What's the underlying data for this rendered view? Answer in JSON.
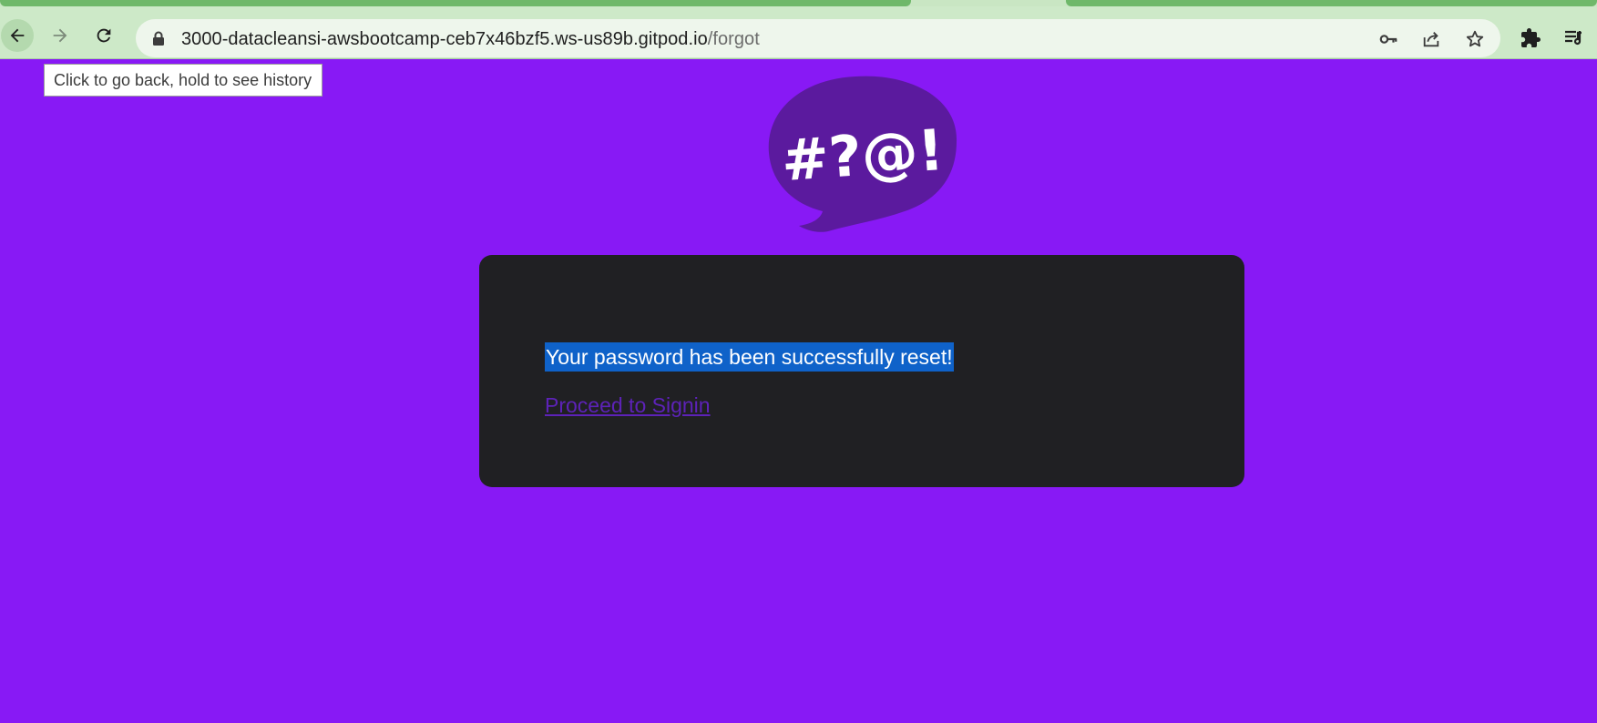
{
  "browser": {
    "url_host": "3000-datacleansi-awsbootcamp-ceb7x46bzf5.ws-us89b.gitpod.io",
    "url_path": "/forgot",
    "back_tooltip": "Click to go back, hold to see history",
    "icons": [
      "back-arrow-icon",
      "forward-arrow-icon",
      "reload-icon",
      "lock-icon",
      "key-icon",
      "share-icon",
      "star-icon",
      "extensions-puzzle-icon",
      "reading-list-icon"
    ]
  },
  "page": {
    "background_color": "#8819f5",
    "logo": {
      "text": "#?@!",
      "bubble_color": "#5b1a9e"
    },
    "card": {
      "background_color": "#202023",
      "message": "Your password has been successfully reset!",
      "link": "Proceed to Signin",
      "link_color": "#5d22b8",
      "selection_color": "#0f62c9"
    }
  }
}
